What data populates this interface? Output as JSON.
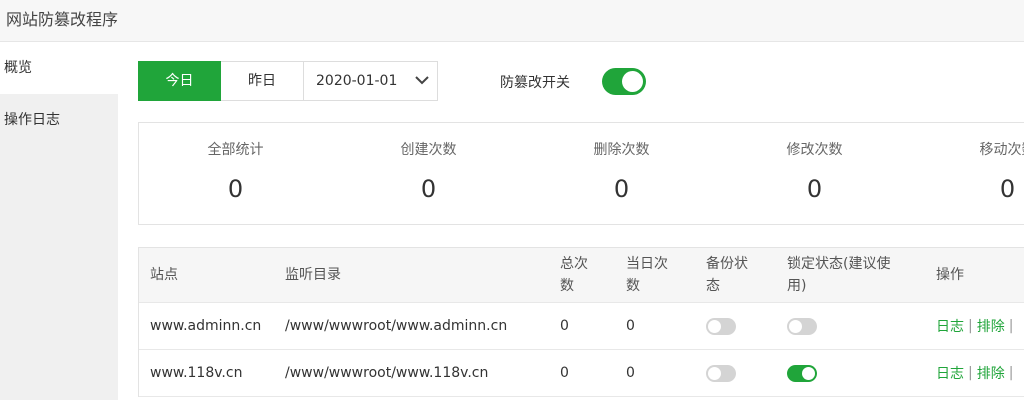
{
  "app": {
    "title": "网站防篡改程序"
  },
  "sidebar": {
    "items": [
      {
        "label": "概览"
      },
      {
        "label": "操作日志"
      }
    ]
  },
  "filters": {
    "today": "今日",
    "yesterday": "昨日",
    "date": "2020-01-01"
  },
  "protect_switch": {
    "label": "防篡改开关",
    "on": true
  },
  "stats": [
    {
      "label": "全部统计",
      "value": "0"
    },
    {
      "label": "创建次数",
      "value": "0"
    },
    {
      "label": "删除次数",
      "value": "0"
    },
    {
      "label": "修改次数",
      "value": "0"
    },
    {
      "label": "移动次数",
      "value": "0"
    }
  ],
  "table": {
    "headers": {
      "site": "站点",
      "dir": "监听目录",
      "total_l1": "总次",
      "total_l2": "数",
      "daily_l1": "当日次",
      "daily_l2": "数",
      "backup_l1": "备份状",
      "backup_l2": "态",
      "lock_l1": "锁定状态(建议使",
      "lock_l2": "用)",
      "ops": "操作"
    },
    "rows": [
      {
        "site": "www.adminn.cn",
        "dir": "/www/wwwroot/www.adminn.cn",
        "total": "0",
        "daily": "0",
        "backup_on": false,
        "lock_on": false,
        "op_log": "日志",
        "op_exclude": "排除"
      },
      {
        "site": "www.118v.cn",
        "dir": "/www/wwwroot/www.118v.cn",
        "total": "0",
        "daily": "0",
        "backup_on": false,
        "lock_on": true,
        "op_log": "日志",
        "op_exclude": "排除"
      }
    ]
  },
  "colors": {
    "accent": "#20a53a",
    "toggle_off": "#d4d4d4"
  }
}
